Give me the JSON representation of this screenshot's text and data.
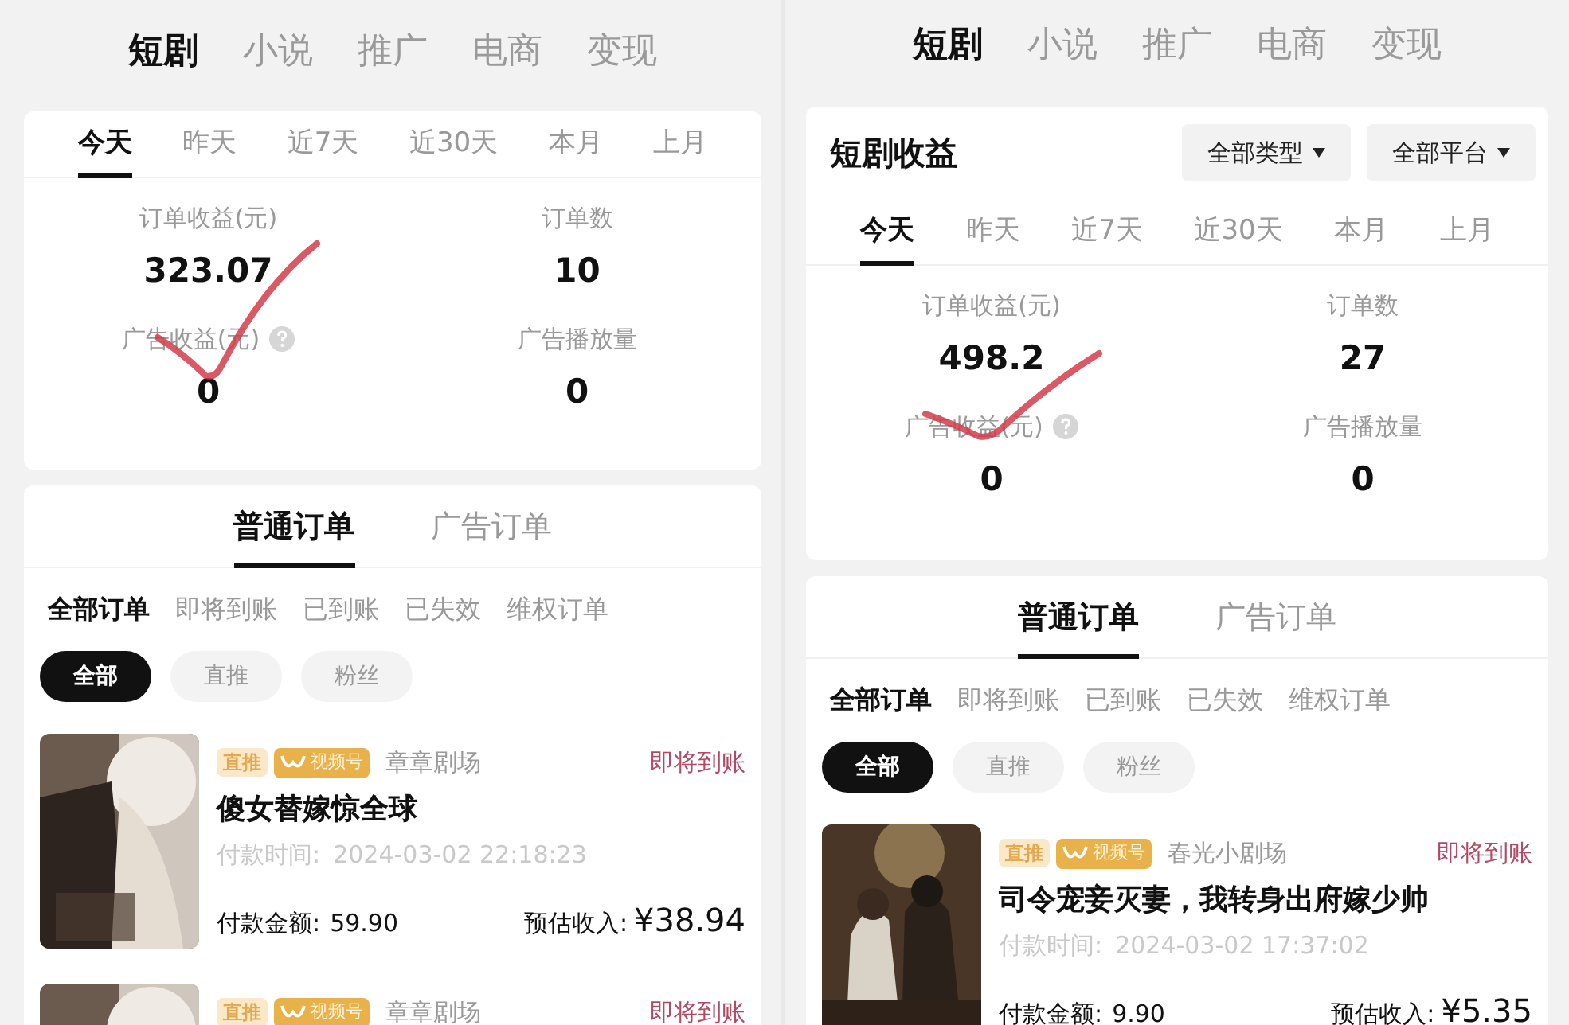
{
  "panels": [
    {
      "nav_tabs": [
        {
          "label": "短剧",
          "selected": true
        },
        {
          "label": "小说",
          "selected": false
        },
        {
          "label": "推广",
          "selected": false
        },
        {
          "label": "电商",
          "selected": false
        },
        {
          "label": "变现",
          "selected": false
        }
      ],
      "summary": {
        "period_tabs": [
          {
            "label": "今天",
            "selected": true
          },
          {
            "label": "昨天",
            "selected": false
          },
          {
            "label": "近7天",
            "selected": false
          },
          {
            "label": "近30天",
            "selected": false
          },
          {
            "label": "本月",
            "selected": false
          },
          {
            "label": "上月",
            "selected": false
          }
        ],
        "stats": [
          {
            "label": "订单收益(元)",
            "value": "323.07",
            "help": false
          },
          {
            "label": "订单数",
            "value": "10",
            "help": false
          },
          {
            "label": "广告收益(元)",
            "value": "0",
            "help": true
          },
          {
            "label": "广告播放量",
            "value": "0",
            "help": false
          }
        ]
      },
      "annotation": {
        "kind": "checkmark"
      },
      "orders": {
        "type_tabs": [
          {
            "label": "普通订单",
            "selected": true
          },
          {
            "label": "广告订单",
            "selected": false
          }
        ],
        "status_tabs": [
          {
            "label": "全部订单",
            "selected": true
          },
          {
            "label": "即将到账",
            "selected": false
          },
          {
            "label": "已到账",
            "selected": false
          },
          {
            "label": "已失效",
            "selected": false
          },
          {
            "label": "维权订单",
            "selected": false
          }
        ],
        "source_chips": [
          {
            "label": "全部",
            "selected": true
          },
          {
            "label": "直推",
            "selected": false
          },
          {
            "label": "粉丝",
            "selected": false
          }
        ],
        "items": [
          {
            "tags": [
              {
                "label": "直推",
                "kind": "source"
              },
              {
                "label": "视频号",
                "kind": "channel"
              }
            ],
            "theater": "章章剧场",
            "status": "即将到账",
            "title": "傻女替嫁惊全球",
            "pay_time_label": "付款时间:",
            "pay_time": "2024-03-02 22:18:23",
            "amount_label": "付款金额:",
            "amount": "59.90",
            "income_label": "预估收入:",
            "income": "¥38.94"
          },
          {
            "tags": [
              {
                "label": "直推",
                "kind": "source"
              },
              {
                "label": "视频号",
                "kind": "channel"
              }
            ],
            "theater": "章章剧场",
            "status": "即将到账"
          }
        ]
      }
    },
    {
      "nav_tabs": [
        {
          "label": "短剧",
          "selected": true
        },
        {
          "label": "小说",
          "selected": false
        },
        {
          "label": "推广",
          "selected": false
        },
        {
          "label": "电商",
          "selected": false
        },
        {
          "label": "变现",
          "selected": false
        }
      ],
      "summary": {
        "title": "短剧收益",
        "filters": [
          "全部类型",
          "全部平台"
        ],
        "period_tabs": [
          {
            "label": "今天",
            "selected": true
          },
          {
            "label": "昨天",
            "selected": false
          },
          {
            "label": "近7天",
            "selected": false
          },
          {
            "label": "近30天",
            "selected": false
          },
          {
            "label": "本月",
            "selected": false
          },
          {
            "label": "上月",
            "selected": false
          }
        ],
        "stats": [
          {
            "label": "订单收益(元)",
            "value": "498.2",
            "help": false
          },
          {
            "label": "订单数",
            "value": "27",
            "help": false
          },
          {
            "label": "广告收益(元)",
            "value": "0",
            "help": true
          },
          {
            "label": "广告播放量",
            "value": "0",
            "help": false
          }
        ]
      },
      "annotation": {
        "kind": "swoosh"
      },
      "orders": {
        "type_tabs": [
          {
            "label": "普通订单",
            "selected": true
          },
          {
            "label": "广告订单",
            "selected": false
          }
        ],
        "status_tabs": [
          {
            "label": "全部订单",
            "selected": true
          },
          {
            "label": "即将到账",
            "selected": false
          },
          {
            "label": "已到账",
            "selected": false
          },
          {
            "label": "已失效",
            "selected": false
          },
          {
            "label": "维权订单",
            "selected": false
          }
        ],
        "source_chips": [
          {
            "label": "全部",
            "selected": true
          },
          {
            "label": "直推",
            "selected": false
          },
          {
            "label": "粉丝",
            "selected": false
          }
        ],
        "items": [
          {
            "tags": [
              {
                "label": "直推",
                "kind": "source"
              },
              {
                "label": "视频号",
                "kind": "channel"
              }
            ],
            "theater": "春光小剧场",
            "status": "即将到账",
            "title": "司令宠妾灭妻，我转身出府嫁少帅",
            "pay_time_label": "付款时间:",
            "pay_time": "2024-03-02 17:37:02",
            "amount_label": "付款金额:",
            "amount": "9.90",
            "income_label": "预估收入:",
            "income": "¥5.35"
          }
        ]
      }
    }
  ]
}
